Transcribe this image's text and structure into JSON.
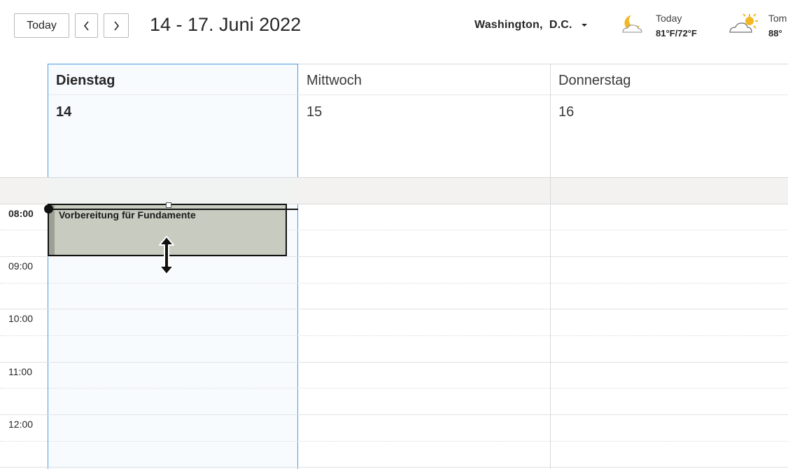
{
  "toolbar": {
    "today_label": "Today",
    "date_range": "14 - 17. Juni 2022",
    "location": "Washington,  D.C.",
    "weather": [
      {
        "label": "Today",
        "temp": "81°F/72°F",
        "icon": "moon-cloud-icon"
      },
      {
        "label": "Tom",
        "temp": "88°",
        "icon": "sun-cloud-icon"
      }
    ]
  },
  "days": [
    {
      "name": "Dienstag",
      "num": "14"
    },
    {
      "name": "Mittwoch",
      "num": "15"
    },
    {
      "name": "Donnerstag",
      "num": "16"
    }
  ],
  "times": [
    "08:00",
    "09:00",
    "10:00",
    "11:00",
    "12:00"
  ],
  "event": {
    "title": "Vorbereitung für Fundamente"
  },
  "colors": {
    "selected_day_bg": "#f8fbfe",
    "selected_day_border": "#4a9ae0",
    "allday_bg": "#f3f2f1",
    "event_bg": "#c8cbc0",
    "grid_line": "#d9d9d9"
  }
}
